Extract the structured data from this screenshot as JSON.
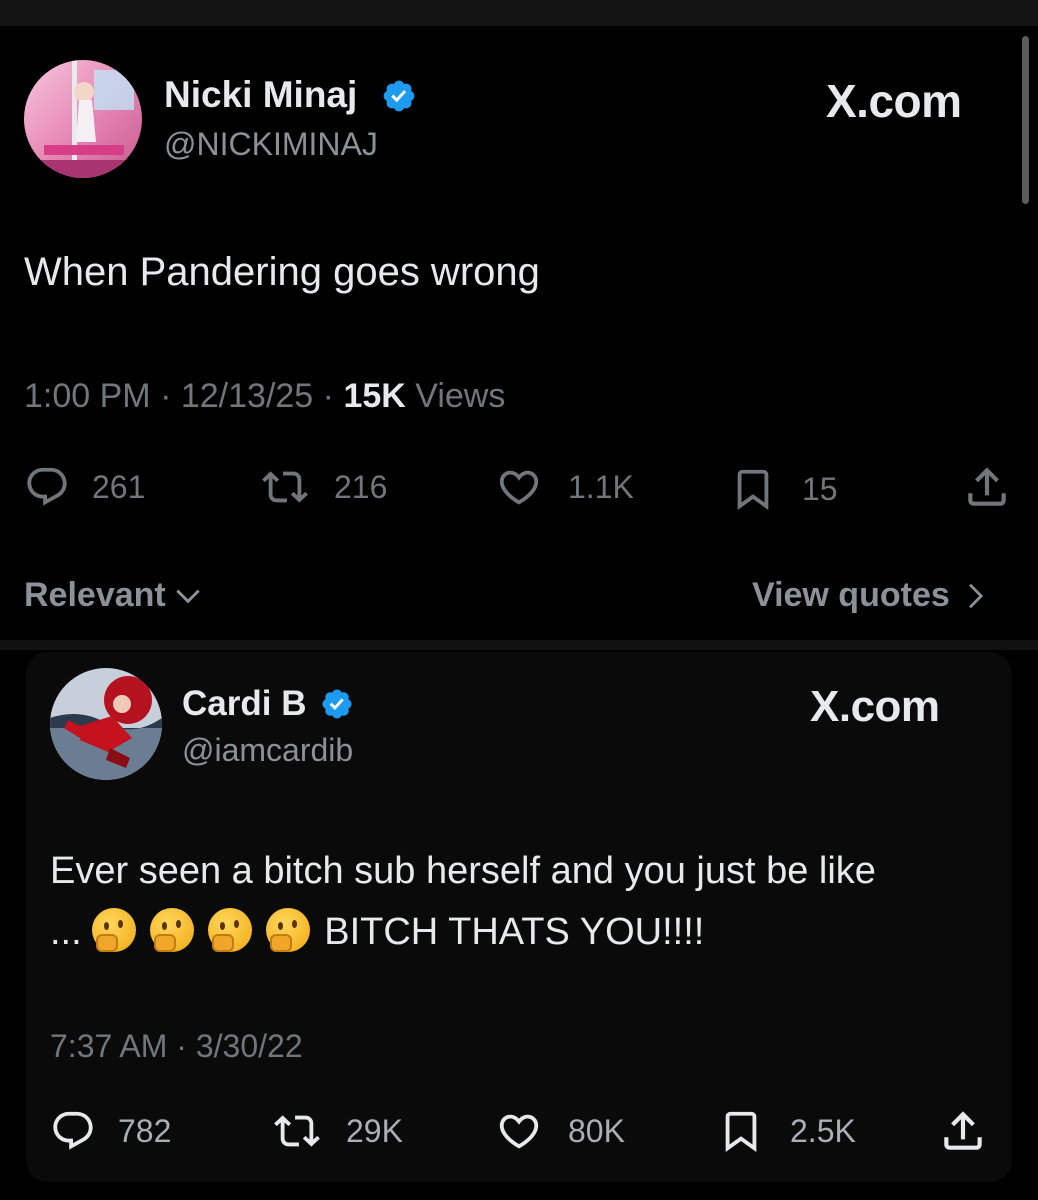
{
  "main_tweet": {
    "author_name": "Nicki Minaj",
    "handle": "@NICKIMINAJ",
    "brand": "X.com",
    "text": "When Pandering goes wrong",
    "time": "1:00 PM",
    "date": "12/13/25",
    "views_count": "15K",
    "views_label": "Views",
    "stats": {
      "replies": "261",
      "reposts": "216",
      "likes": "1.1K",
      "bookmarks": "15"
    }
  },
  "filters": {
    "sort_label": "Relevant",
    "view_quotes_label": "View quotes"
  },
  "quoted_tweet": {
    "author_name": "Cardi B",
    "handle": "@iamcardib",
    "brand": "X.com",
    "text_line1": "Ever seen a bitch sub herself and you just be like",
    "text_line2_prefix": "...",
    "text_line2_suffix": "BITCH THATS YOU!!!!",
    "time": "7:37 AM",
    "date": "3/30/22",
    "stats": {
      "replies": "782",
      "reposts": "29K",
      "likes": "80K",
      "bookmarks": "2.5K"
    }
  },
  "colors": {
    "background": "#000000",
    "verified_badge": "#1d9bf0",
    "primary_text": "#e7e9ea",
    "secondary_text": "#71767b"
  }
}
